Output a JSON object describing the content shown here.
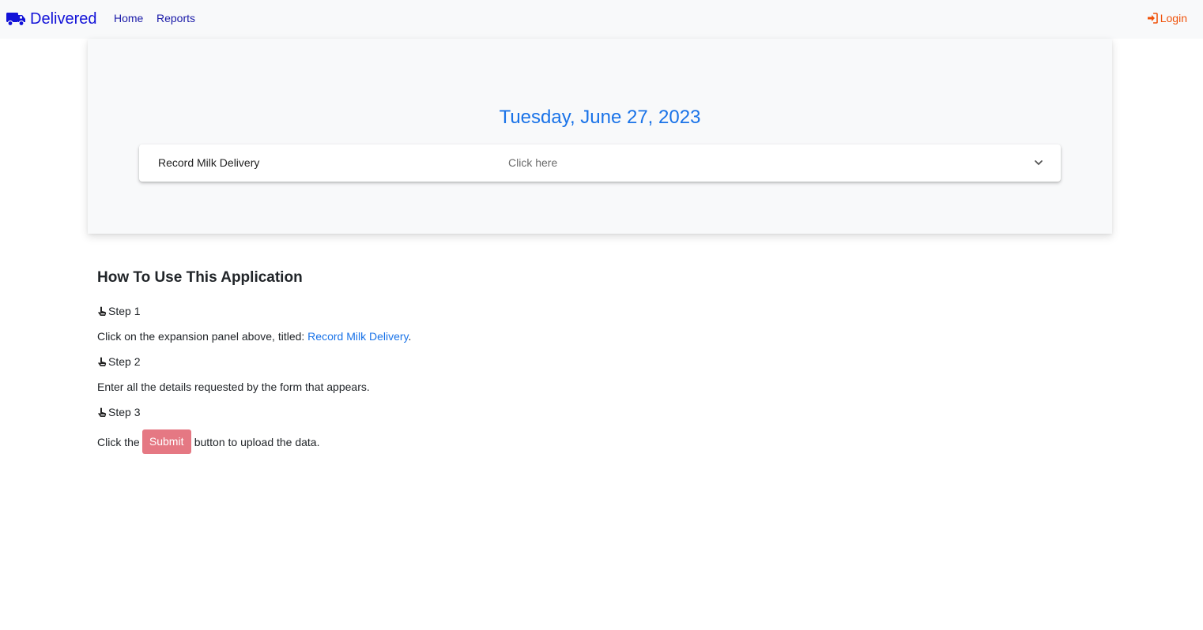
{
  "navbar": {
    "brand": "Delivered",
    "links": [
      "Home",
      "Reports"
    ],
    "login": "Login"
  },
  "hero": {
    "date": "Tuesday, June 27, 2023",
    "panel": {
      "title": "Record Milk Delivery",
      "description": "Click here"
    }
  },
  "howto": {
    "title": "How To Use This Application",
    "steps": [
      {
        "label": "Step 1",
        "text_before": "Click on the expansion panel above, titled: ",
        "link": "Record Milk Delivery",
        "text_after": "."
      },
      {
        "label": "Step 2",
        "text": "Enter all the details requested by the form that appears."
      },
      {
        "label": "Step 3",
        "text_before": "Click the",
        "button": "Submit",
        "text_after": "button to upload the data."
      }
    ]
  },
  "colors": {
    "brand": "#1212d8",
    "accent": "#1a73e8",
    "login": "#f0520a",
    "submit": "#e57883"
  },
  "icons": {
    "brand": "truck-icon",
    "login": "sign-in-icon",
    "panel": "chevron-down-icon",
    "step": "hand-pointer-icon"
  }
}
